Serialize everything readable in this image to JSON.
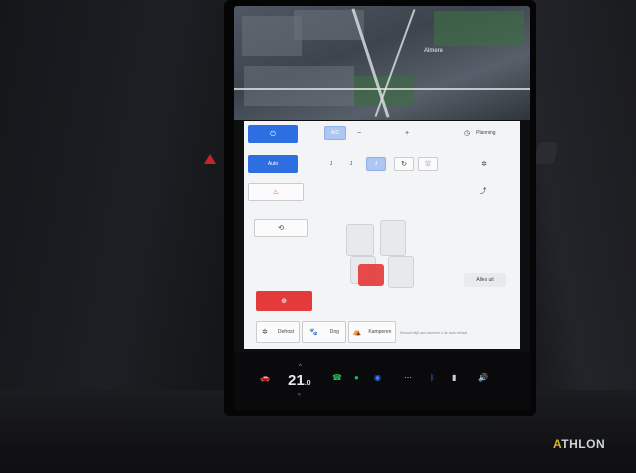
{
  "map": {
    "city_label": "Almere"
  },
  "climate": {
    "power_icon": "⏻",
    "ac_label": "A/C",
    "minus_label": "−",
    "plus_label": "+",
    "auto_label": "Auto",
    "fan_labels": [
      "J",
      "J",
      "J"
    ],
    "defrost_icon": "⛆",
    "recirc_icon": "↻",
    "seat_heat_icon": "♨",
    "max_defrost_icon": "⊕",
    "steering_icon": "⟲",
    "preheat_label": "Planning",
    "clock_icon": "◷",
    "fan_icon": "✲",
    "airflow_icon": "⤴",
    "modes": [
      {
        "icon": "✲",
        "label": "Defrost"
      },
      {
        "icon": "🐾",
        "label": "Dog"
      },
      {
        "icon": "⛺",
        "label": "Kamperen"
      }
    ],
    "seat_off_label": "Alles uit",
    "note_text": "Klimaat blijft aan wanneer u de auto verlaat"
  },
  "status_bar": {
    "temperature": "21",
    "temperature_decimal": ".0",
    "temp_up": "^",
    "temp_down": "≈",
    "icons": {
      "car": "🚗",
      "phone": "☎",
      "spotify": "●",
      "navigation": "◉",
      "apps": "⋯",
      "bluetooth": "ᛒ",
      "battery": "▮",
      "volume": "🔊"
    }
  },
  "watermark": {
    "logo_a": "A",
    "logo_rest": "THLON"
  },
  "colors": {
    "accent_blue": "#2d6fe0",
    "heat_red": "#e53a3a",
    "spotify_green": "#1db954"
  }
}
